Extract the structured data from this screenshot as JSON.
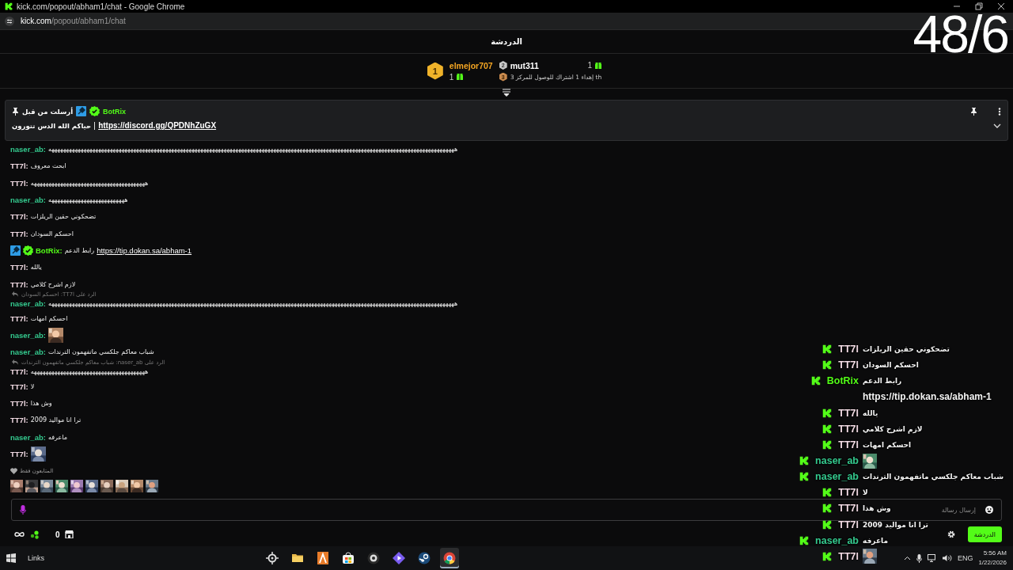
{
  "window": {
    "title": "kick.com/popout/abham1/chat - Google Chrome"
  },
  "address_bar": {
    "domain": "kick.com",
    "path": "/popout/abham1/chat"
  },
  "viewer_counter": "48/6",
  "chat_header": {
    "title": "الدردشة"
  },
  "leaderboard": {
    "first": {
      "rank": "1",
      "name": "elmejor707",
      "gifts": "1"
    },
    "second": {
      "rank": "2",
      "name": "mut311",
      "gifts": "1"
    },
    "third": {
      "rank": "3",
      "text": "3 إهداء 1 اشتراك للوصول للمركز th"
    }
  },
  "pinned": {
    "sender_prefix": "أرسلت من قبل",
    "sender": "BotRix",
    "text": "حياكم الله الدس تتورون",
    "link": "https://discord.gg/QPDNhZuGX"
  },
  "messages": [
    {
      "user": "naser_ab:",
      "color": "#34c98e",
      "kind": "text",
      "text": "هههههههههههههههههههههههههههههههههههههههههههههههههههههههههههههههههههههههههههههههههههههههههههههههههههههههههههههههههههههههههههههههههههههههههههه"
    },
    {
      "user": "TT7l:",
      "color": "#f2dbe4",
      "kind": "text",
      "text": "ابحث معروف"
    },
    {
      "user": "TT7l:",
      "color": "#f2dbe4",
      "kind": "text",
      "text": "هههههههههههههههههههههههههههههههههههههههه"
    },
    {
      "user": "naser_ab:",
      "color": "#34c98e",
      "kind": "text",
      "text": "ههههههههههههههههههههههههههه"
    },
    {
      "user": "TT7l:",
      "color": "#f2dbe4",
      "kind": "text",
      "text": "تضحكوني حقين الريلزات"
    },
    {
      "user": "TT7l:",
      "color": "#f2dbe4",
      "kind": "text",
      "text": "احسكم السودان"
    },
    {
      "user": "BotRix:",
      "color": "#53fc18",
      "kind": "link",
      "badges": true,
      "text": "رابط الدعم",
      "link": "https://tip.dokan.sa/abham-1"
    },
    {
      "user": "TT7l:",
      "color": "#f2dbe4",
      "kind": "text",
      "text": "يالله"
    },
    {
      "user": "TT7l:",
      "color": "#f2dbe4",
      "kind": "text",
      "text": "لازم اشرح كلامي"
    },
    {
      "user": "naser_ab:",
      "color": "#34c98e",
      "kind": "text",
      "reply_to": "الرد على TT7l: احسكم السودان",
      "text": "هههههههههههههههههههههههههههههههههههههههههههههههههههههههههههههههههههههههههههههههههههههههههههههههههههههههههههههههههههههههههههههههههههههههههههه"
    },
    {
      "user": "TT7l:",
      "color": "#f2dbe4",
      "kind": "text",
      "text": "احسكم امهات"
    },
    {
      "user": "naser_ab:",
      "color": "#34c98e",
      "kind": "emote"
    },
    {
      "user": "naser_ab:",
      "color": "#34c98e",
      "kind": "text",
      "text": "شباب معاكم جلكسي ماتفهمون الترندات"
    },
    {
      "user": "TT7l:",
      "color": "#f2dbe4",
      "kind": "text",
      "reply_to": "الرد على naser_ab: شباب معاكم جلكسي ماتفهمون الترندات",
      "text": "هههههههههههههههههههههههههههههههههههههههه"
    },
    {
      "user": "TT7l:",
      "color": "#f2dbe4",
      "kind": "text",
      "text": "لا"
    },
    {
      "user": "TT7l:",
      "color": "#f2dbe4",
      "kind": "text",
      "text": "وش هذا"
    },
    {
      "user": "TT7l:",
      "color": "#f2dbe4",
      "kind": "text",
      "text": "ترا انا مواليد 2009"
    },
    {
      "user": "naser_ab:",
      "color": "#34c98e",
      "kind": "text",
      "text": "ماعرفه"
    },
    {
      "user": "TT7l:",
      "color": "#f2dbe4",
      "kind": "emote"
    }
  ],
  "followers_only": "المتابعون فقط",
  "chat_input": {
    "placeholder": "إرسال رسالة"
  },
  "chat_footer": {
    "points": "0",
    "send_label": "الدردشة"
  },
  "overlay_chat": [
    {
      "user": "TT7l",
      "color": "#f2dbe4",
      "kind": "text",
      "text": "تضحكوني حقين الريلزات"
    },
    {
      "user": "TT7l",
      "color": "#f2dbe4",
      "kind": "text",
      "text": "احسكم السودان"
    },
    {
      "user": "BotRix",
      "color": "#53fc18",
      "kind": "link",
      "text": "رابط الدعم",
      "link": "https://tip.dokan.sa/abham-1"
    },
    {
      "user": "TT7l",
      "color": "#f2dbe4",
      "kind": "text",
      "text": "يالله"
    },
    {
      "user": "TT7l",
      "color": "#f2dbe4",
      "kind": "text",
      "text": "لازم اشرح كلامي"
    },
    {
      "user": "TT7l",
      "color": "#f2dbe4",
      "kind": "text",
      "text": "احسكم امهات"
    },
    {
      "user": "naser_ab",
      "color": "#34c98e",
      "kind": "emote"
    },
    {
      "user": "naser_ab",
      "color": "#34c98e",
      "kind": "text",
      "text": "شباب معاكم جلكسي ماتفهمون الترندات"
    },
    {
      "user": "TT7l",
      "color": "#f2dbe4",
      "kind": "text",
      "text": "لا"
    },
    {
      "user": "TT7l",
      "color": "#f2dbe4",
      "kind": "text",
      "text": "وش هذا"
    },
    {
      "user": "TT7l",
      "color": "#f2dbe4",
      "kind": "text",
      "text": "ترا انا مواليد 2009"
    },
    {
      "user": "naser_ab",
      "color": "#34c98e",
      "kind": "text",
      "text": "ماعرفه"
    },
    {
      "user": "TT7l",
      "color": "#f2dbe4",
      "kind": "emote"
    }
  ],
  "taskbar": {
    "links_label": "Links",
    "apps": [
      {
        "kind": "target",
        "active": false
      },
      {
        "kind": "folder",
        "active": false
      },
      {
        "kind": "tile",
        "active": false
      },
      {
        "kind": "store",
        "active": false
      },
      {
        "kind": "disc",
        "active": false
      },
      {
        "kind": "play",
        "active": false
      },
      {
        "kind": "steam",
        "active": false
      },
      {
        "kind": "browser",
        "active": true
      }
    ],
    "language": "ENG",
    "time": "5:56 AM",
    "date": "1/22/2026"
  }
}
